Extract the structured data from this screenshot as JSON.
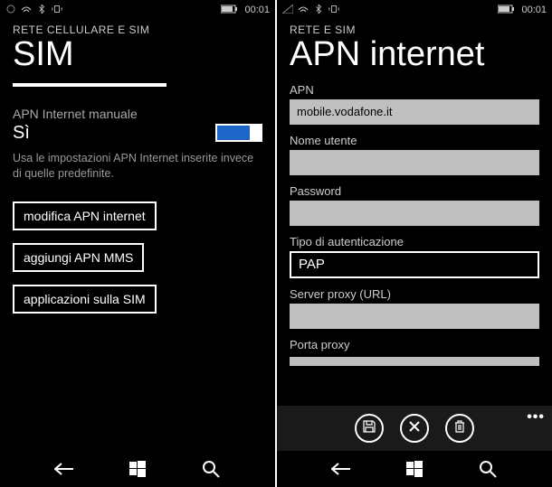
{
  "status": {
    "time": "00:01"
  },
  "left": {
    "breadcrumb": "RETE CELLULARE E SIM",
    "title": "SIM",
    "manual_apn_label": "APN Internet manuale",
    "manual_apn_value": "Sì",
    "desc": "Usa le impostazioni APN Internet inserite invece di quelle predefinite.",
    "btn_modify": "modifica APN internet",
    "btn_add_mms": "aggiungi APN MMS",
    "btn_sim_apps": "applicazioni sulla SIM"
  },
  "right": {
    "breadcrumb": "RETE E SIM",
    "title": "APN internet",
    "fields": {
      "apn_label": "APN",
      "apn_value": "mobile.vodafone.it",
      "user_label": "Nome utente",
      "user_value": "",
      "password_label": "Password",
      "password_value": "",
      "auth_label": "Tipo di autenticazione",
      "auth_value": "PAP",
      "proxy_url_label": "Server proxy (URL)",
      "proxy_url_value": "",
      "proxy_port_label": "Porta proxy"
    }
  }
}
